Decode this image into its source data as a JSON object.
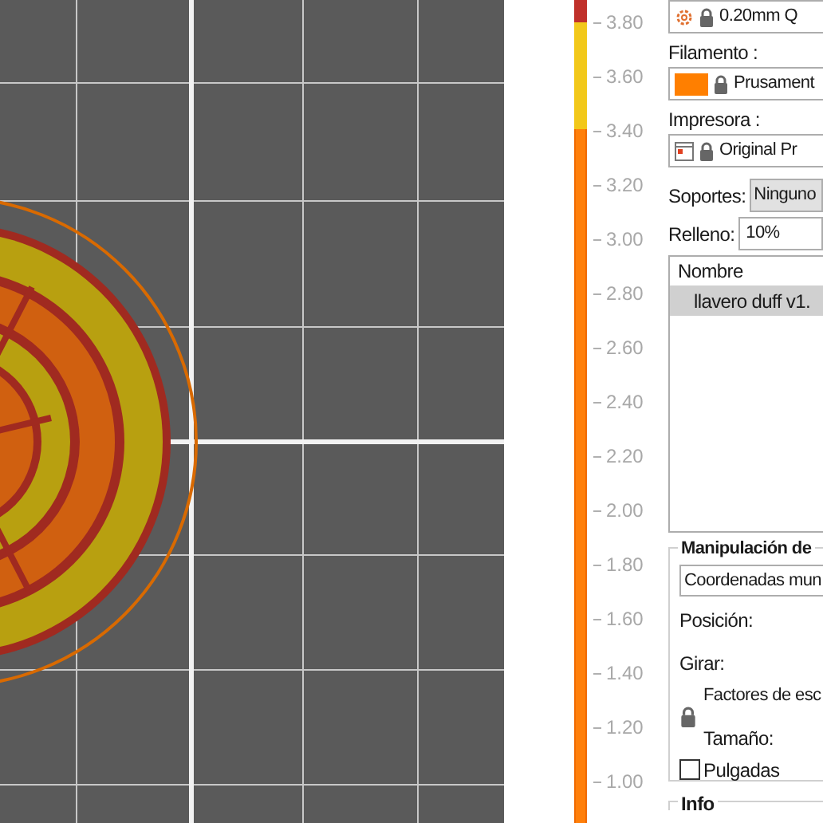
{
  "layer_slider": {
    "ticks": [
      "3.80",
      "3.60",
      "3.40",
      "3.20",
      "3.00",
      "2.80",
      "2.60",
      "2.40",
      "2.20",
      "2.00",
      "1.80",
      "1.60",
      "1.40",
      "1.20",
      "1.00"
    ]
  },
  "settings": {
    "print_profile": "0.20mm Q",
    "filament_label": "Filamento :",
    "filament": {
      "name": "Prusament",
      "color": "#ff7f00"
    },
    "printer_label": "Impresora :",
    "printer": "Original Pr",
    "supports_label": "Soportes:",
    "supports": "Ninguno",
    "infill_label": "Relleno:",
    "infill": "10%"
  },
  "object_list": {
    "column": "Nombre",
    "rows": [
      {
        "name": "llavero duff v1.",
        "selected": true
      }
    ]
  },
  "manipulation": {
    "title": "Manipulación de",
    "coordinates": "Coordenadas mun",
    "position_label": "Posición:",
    "rotate_label": "Girar:",
    "scale_label": "Factores de esc",
    "size_label": "Tamaño:",
    "inches": {
      "label": "Pulgadas",
      "checked": false
    }
  },
  "info": {
    "title": "Info"
  }
}
